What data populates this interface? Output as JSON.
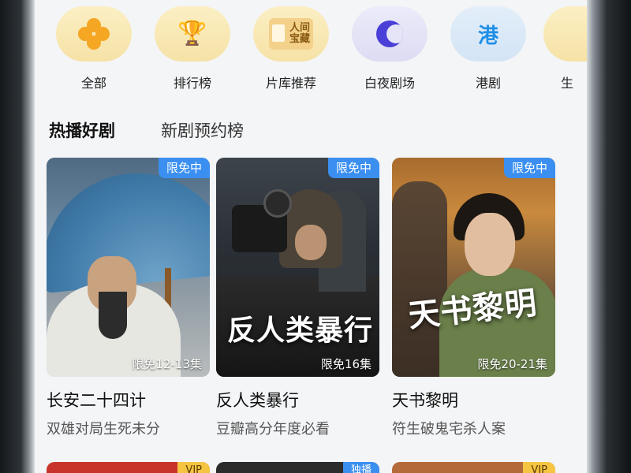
{
  "categories": [
    {
      "label": "全部",
      "icon": "four-petal-flower-icon"
    },
    {
      "label": "排行榜",
      "icon": "trophy-icon"
    },
    {
      "label": "片库推荐",
      "icon": "film-library-icon",
      "icon_text_1": "人间",
      "icon_text_2": "宝藏"
    },
    {
      "label": "白夜剧场",
      "icon": "crescent-moon-icon"
    },
    {
      "label": "港剧",
      "icon": "hk-icon",
      "icon_text": "港"
    },
    {
      "label": "生",
      "icon": "partial-icon"
    }
  ],
  "tabs": [
    {
      "label": "热播好剧",
      "active": true
    },
    {
      "label": "新剧预约榜",
      "active": false
    }
  ],
  "cards": [
    {
      "badge": "限免中",
      "episodes": "限免12-13集",
      "title": "长安二十四计",
      "subtitle": "双雄对局生死未分"
    },
    {
      "badge": "限免中",
      "episodes": "限免16集",
      "poster_title": "反人类暴行",
      "title": "反人类暴行",
      "subtitle": "豆瓣高分年度必看"
    },
    {
      "badge": "限免中",
      "episodes": "限免20-21集",
      "poster_title": "天书黎明",
      "title": "天书黎明",
      "subtitle": "符生破鬼宅杀人案"
    }
  ],
  "next_row": [
    {
      "badge": "VIP",
      "color": "#f5c542"
    },
    {
      "badge": "独播",
      "color": "#3a8ff0"
    },
    {
      "badge": "VIP",
      "color": "#f5c542"
    }
  ],
  "colors": {
    "badge_blue": "#3a8ff0",
    "accent_yellow": "#f5a623"
  }
}
